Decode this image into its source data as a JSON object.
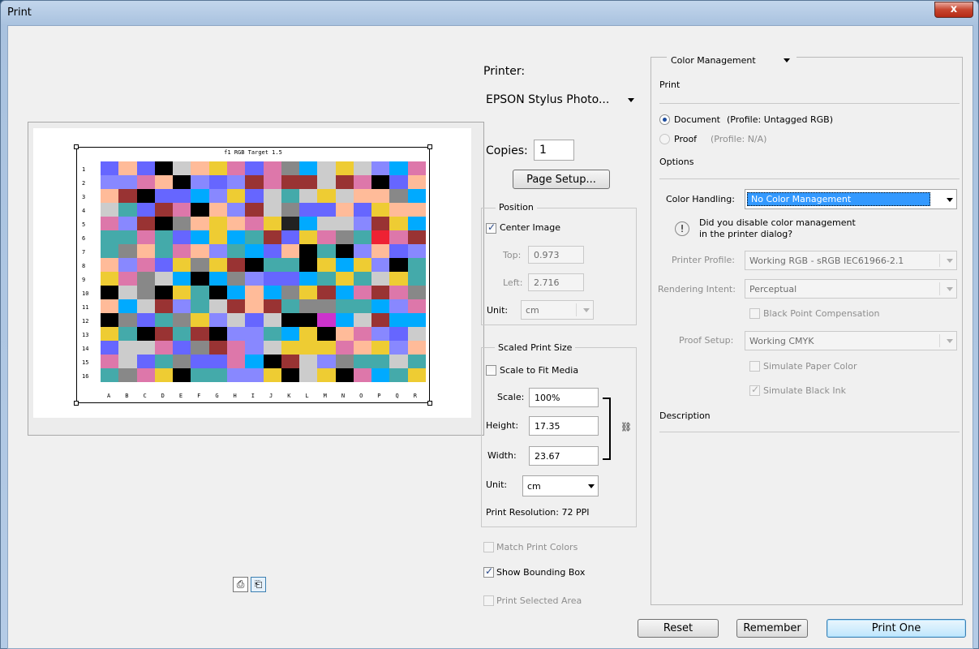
{
  "window": {
    "title": "Print",
    "close_label": "x"
  },
  "printer": {
    "label": "Printer:",
    "value": "EPSON Stylus Photo..."
  },
  "copies": {
    "label": "Copies:",
    "value": "1"
  },
  "page_setup_label": "Page Setup...",
  "preview": {
    "target_title": "f1 RGB Target 1.5",
    "row_labels": [
      "1",
      "2",
      "3",
      "4",
      "5",
      "6",
      "7",
      "8",
      "9",
      "10",
      "11",
      "12",
      "13",
      "14",
      "15",
      "16"
    ],
    "col_labels": [
      "A",
      "B",
      "C",
      "D",
      "E",
      "F",
      "G",
      "H",
      "I",
      "J",
      "K",
      "L",
      "M",
      "N",
      "O",
      "P",
      "Q",
      "R"
    ]
  },
  "position": {
    "group_label": "Position",
    "center_image_label": "Center Image",
    "center_image_checked": true,
    "top_label": "Top:",
    "top_value": "0.973",
    "left_label": "Left:",
    "left_value": "2.716",
    "unit_label": "Unit:",
    "unit_value": "cm"
  },
  "scaled": {
    "group_label": "Scaled Print Size",
    "scale_to_fit_label": "Scale to Fit Media",
    "scale_to_fit_checked": false,
    "scale_label": "Scale:",
    "scale_value": "100%",
    "height_label": "Height:",
    "height_value": "17.35",
    "width_label": "Width:",
    "width_value": "23.67",
    "unit_label": "Unit:",
    "unit_value": "cm",
    "resolution": "Print Resolution: 72 PPI"
  },
  "options_left": {
    "match_print_colors": "Match Print Colors",
    "show_bounding_box": "Show Bounding Box",
    "print_selected_area": "Print Selected Area"
  },
  "right": {
    "section_dropdown": "Color Management",
    "print_heading": "Print",
    "document_label": "Document",
    "document_profile": "(Profile: Untagged RGB)",
    "proof_label": "Proof",
    "proof_profile": "(Profile: N/A)",
    "options_heading": "Options",
    "color_handling_label": "Color Handling:",
    "color_handling_value": "No Color Management",
    "warning_line1": "Did you disable color management",
    "warning_line2": "in the printer dialog?",
    "printer_profile_label": "Printer Profile:",
    "printer_profile_value": "Working RGB - sRGB IEC61966-2.1",
    "rendering_intent_label": "Rendering Intent:",
    "rendering_intent_value": "Perceptual",
    "black_point_label": "Black Point Compensation",
    "proof_setup_label": "Proof Setup:",
    "proof_setup_value": "Working CMYK",
    "simulate_paper_label": "Simulate Paper Color",
    "simulate_black_label": "Simulate Black Ink",
    "description_heading": "Description"
  },
  "buttons": {
    "reset": "Reset",
    "remember": "Remember",
    "print_one": "Print One"
  }
}
